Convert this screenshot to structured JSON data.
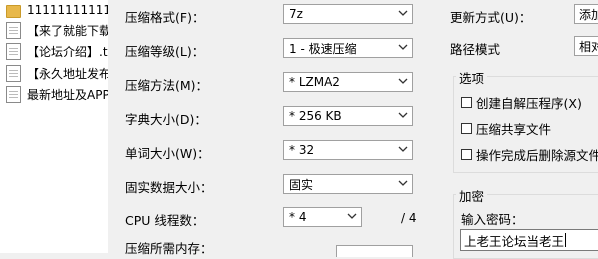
{
  "file_list": [
    {
      "name": "1111111111111",
      "type": "folder"
    },
    {
      "name": "【来了就能下载",
      "type": "doc"
    },
    {
      "name": "【论坛介绍】.t",
      "type": "doc"
    },
    {
      "name": "【永久地址发布",
      "type": "doc"
    },
    {
      "name": "最新地址及APP",
      "type": "doc"
    }
  ],
  "left": {
    "format_label": "压缩格式(F)：",
    "format_value": "7z",
    "level_label": "压缩等级(L)：",
    "level_value": "1 - 极速压缩",
    "method_label": "压缩方法(M)：",
    "method_value": "* LZMA2",
    "dict_label": "字典大小(D)：",
    "dict_value": "* 256 KB",
    "word_label": "单词大小(W)：",
    "word_value": "* 32",
    "solid_label": "固实数据大小：",
    "solid_value": "固实",
    "cpu_label": "CPU 线程数：",
    "cpu_value": "* 4",
    "cpu_max": "/ 4",
    "mem_label": "压缩所需内存："
  },
  "right": {
    "update_label": "更新方式(U)：",
    "update_value": "添加",
    "path_label": "路径模式",
    "path_value": "相对",
    "options_title": "选项",
    "options": [
      {
        "label": "创建自解压程序(X)",
        "checked": false
      },
      {
        "label": "压缩共享文件",
        "checked": false
      },
      {
        "label": "操作完成后删除源文件",
        "checked": false
      }
    ],
    "encrypt_title": "加密",
    "password_label": "输入密码：",
    "password_value": "上老王论坛当老王"
  }
}
